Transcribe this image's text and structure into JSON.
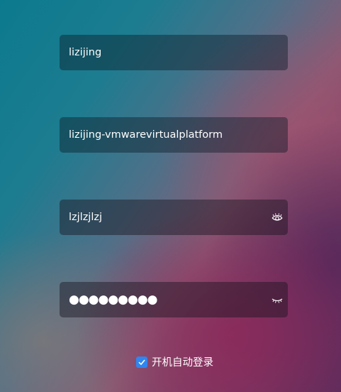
{
  "login_form": {
    "username": {
      "value": "lizijing"
    },
    "hostname": {
      "value": "lizijing-vmwarevirtualplatform"
    },
    "password_visible": {
      "value": "lzjlzjlzj",
      "toggle_icon": "eye-open-icon"
    },
    "password_masked": {
      "value": "●●●●●●●●●",
      "toggle_icon": "eye-closed-icon"
    },
    "auto_login": {
      "label": "开机自动登录",
      "checked": true,
      "accent": "#2f86f0"
    }
  }
}
